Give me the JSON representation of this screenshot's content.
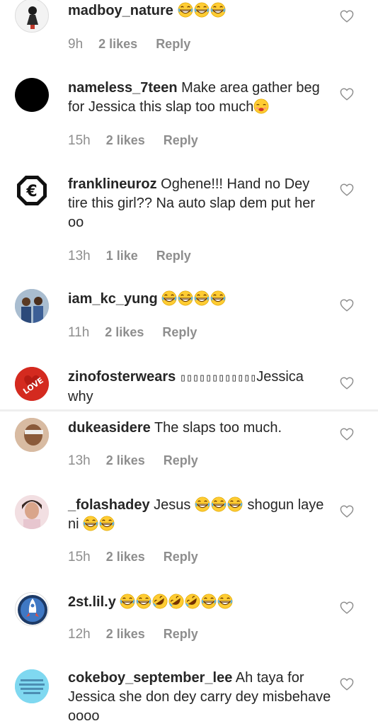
{
  "comments": [
    {
      "username": "madboy_nature",
      "text": "",
      "emojis": [
        "grin",
        "grin",
        "grin"
      ],
      "text_after": "",
      "time": "9h",
      "likes": "2 likes",
      "reply": "Reply"
    },
    {
      "username": "nameless_7teen",
      "text": "Make area gather beg for Jessica this slap too much",
      "emojis": [
        "kiss"
      ],
      "text_after": "",
      "time": "15h",
      "likes": "2 likes",
      "reply": "Reply"
    },
    {
      "username": "franklineuroz",
      "text": "Oghene!!! Hand no Dey tire this girl?? Na auto slap dem put her oo",
      "emojis": [],
      "text_after": "",
      "time": "13h",
      "likes": "1 like",
      "reply": "Reply"
    },
    {
      "username": "iam_kc_yung",
      "text": "",
      "emojis": [
        "grin",
        "grin",
        "grin",
        "grin"
      ],
      "text_after": "",
      "time": "11h",
      "likes": "2 likes",
      "reply": "Reply"
    },
    {
      "username": "zinofosterwears",
      "text": "▯▯▯▯▯▯▯▯▯▯▯▯",
      "emojis": [],
      "text_after": "Jessica why",
      "time": "",
      "likes": "",
      "reply": ""
    },
    {
      "username": "dukeasidere",
      "text": "The slaps too much.",
      "emojis": [],
      "text_after": "",
      "time": "13h",
      "likes": "2 likes",
      "reply": "Reply"
    },
    {
      "username": "_folashadey",
      "text": "Jesus",
      "emojis": [
        "grin",
        "grin",
        "grin"
      ],
      "text_after": "shogun laye ni",
      "emojis_after": [
        "grin",
        "grin"
      ],
      "time": "15h",
      "likes": "2 likes",
      "reply": "Reply"
    },
    {
      "username": "2st.lil.y",
      "text": "",
      "emojis": [
        "grin",
        "grin",
        "rofl",
        "rofl",
        "rofl",
        "grin",
        "grin"
      ],
      "text_after": "",
      "time": "12h",
      "likes": "2 likes",
      "reply": "Reply"
    },
    {
      "username": "cokeboy_september_lee",
      "text": "Ah taya for Jessica she don dey carry dey misbehave oooo",
      "emojis": [],
      "text_after": "",
      "time": "",
      "likes": "",
      "reply": ""
    }
  ],
  "avatar_text": {
    "love": "LOVE"
  },
  "icons": {
    "like": "heart-outline-icon"
  },
  "colors": {
    "text": "#262626",
    "meta": "#8e8e8e",
    "divider": "#efefef"
  }
}
